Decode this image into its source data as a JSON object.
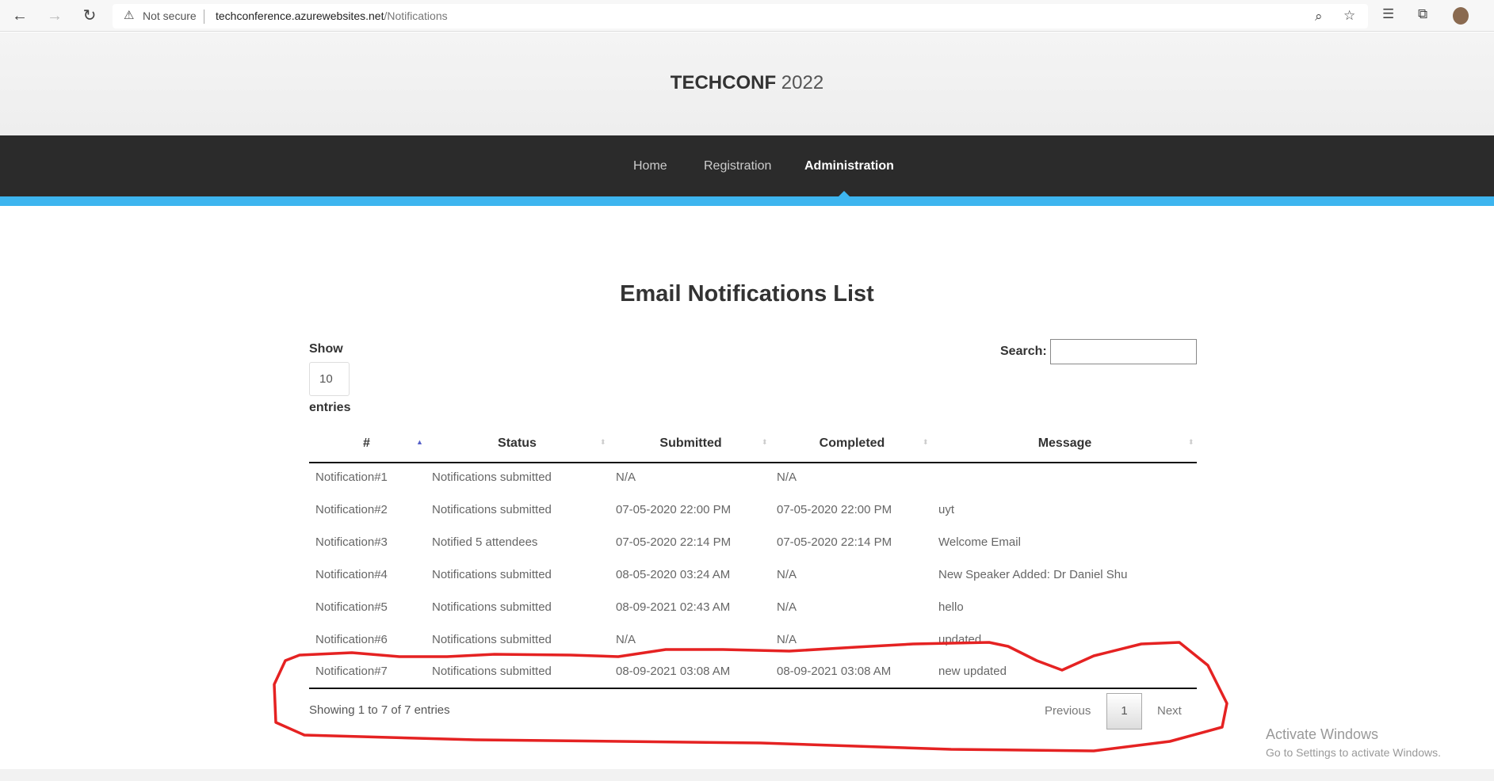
{
  "browser": {
    "security_label": "Not secure",
    "url_host": "techconference.azurewebsites.net",
    "url_path": "/Notifications"
  },
  "site": {
    "brand_bold": "TECHCONF",
    "brand_year": "2022"
  },
  "nav": {
    "items": [
      {
        "label": "Home"
      },
      {
        "label": "Registration"
      },
      {
        "label": "Administration",
        "active": true
      }
    ]
  },
  "page": {
    "title": "Email Notifications List"
  },
  "controls": {
    "show_label": "Show",
    "page_length": "10",
    "entries_label": "entries",
    "search_label": "Search:",
    "search_value": ""
  },
  "table": {
    "columns": [
      "#",
      "Status",
      "Submitted",
      "Completed",
      "Message"
    ],
    "sorted_column": "#",
    "rows": [
      [
        "Notification#1",
        "Notifications submitted",
        "N/A",
        "N/A",
        ""
      ],
      [
        "Notification#2",
        "Notifications submitted",
        "07-05-2020 22:00 PM",
        "07-05-2020 22:00 PM",
        "uyt"
      ],
      [
        "Notification#3",
        "Notified 5 attendees",
        "07-05-2020 22:14 PM",
        "07-05-2020 22:14 PM",
        "Welcome Email"
      ],
      [
        "Notification#4",
        "Notifications submitted",
        "08-05-2020 03:24 AM",
        "N/A",
        "New Speaker Added: Dr Daniel Shu"
      ],
      [
        "Notification#5",
        "Notifications submitted",
        "08-09-2021 02:43 AM",
        "N/A",
        "hello"
      ],
      [
        "Notification#6",
        "Notifications submitted",
        "N/A",
        "N/A",
        "updated"
      ],
      [
        "Notification#7",
        "Notifications submitted",
        "08-09-2021 03:08 AM",
        "08-09-2021 03:08 AM",
        "new updated"
      ]
    ]
  },
  "footer": {
    "info": "Showing 1 to 7 of 7 entries",
    "previous": "Previous",
    "current_page": "1",
    "next": "Next"
  },
  "watermark": {
    "line1": "Activate Windows",
    "line2": "Go to Settings to activate Windows."
  },
  "colors": {
    "accent": "#3db5ef",
    "nav_bg": "#2b2b2b",
    "annotation": "#e52222"
  }
}
